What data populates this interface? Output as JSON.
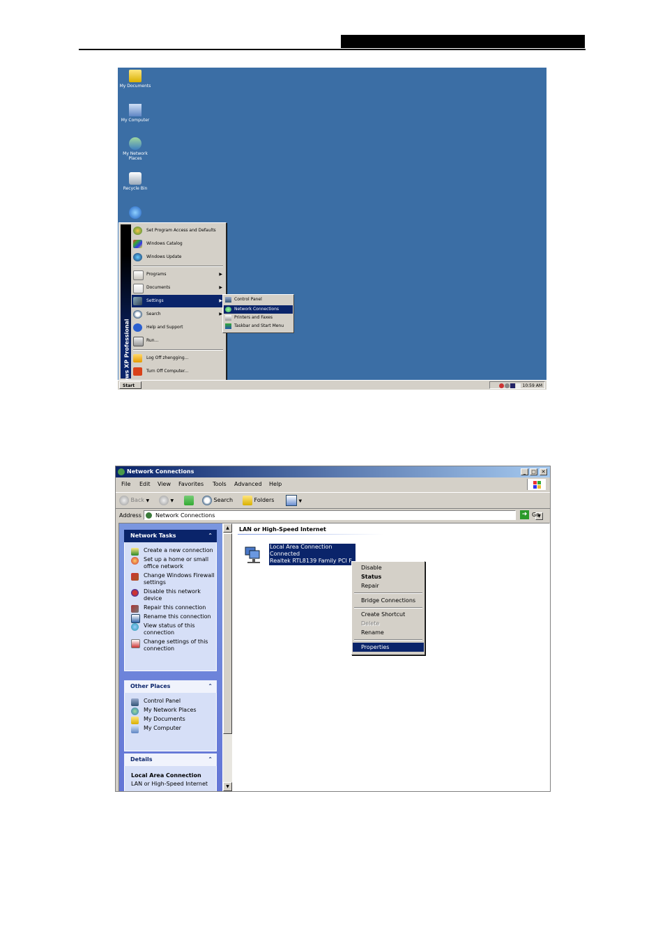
{
  "desktop": {
    "icons": [
      {
        "label": "My Documents"
      },
      {
        "label": "My Computer"
      },
      {
        "label": "My Network Places"
      },
      {
        "label": "Recycle Bin"
      }
    ],
    "start_menu": {
      "band_text": "Windows XP  Professional",
      "items": [
        {
          "label": "Set Program Access and Defaults"
        },
        {
          "label": "Windows Catalog"
        },
        {
          "label": "Windows Update"
        },
        {
          "label": "Programs"
        },
        {
          "label": "Documents"
        },
        {
          "label": "Settings"
        },
        {
          "label": "Search"
        },
        {
          "label": "Help and Support"
        },
        {
          "label": "Run..."
        },
        {
          "label": "Log Off zhengging..."
        },
        {
          "label": "Turn Off Computer..."
        }
      ]
    },
    "settings_submenu": [
      {
        "label": "Control Panel"
      },
      {
        "label": "Network Connections"
      },
      {
        "label": "Printers and Faxes"
      },
      {
        "label": "Taskbar and Start Menu"
      }
    ],
    "taskbar": {
      "start_label": "Start",
      "clock": "10:59 AM"
    }
  },
  "window": {
    "title": "Network Connections",
    "menu": [
      "File",
      "Edit",
      "View",
      "Favorites",
      "Tools",
      "Advanced",
      "Help"
    ],
    "toolbar": {
      "back": "Back",
      "search": "Search",
      "folders": "Folders"
    },
    "address": {
      "label": "Address",
      "value": "Network Connections",
      "go": "Go"
    },
    "network_tasks": {
      "title": "Network Tasks",
      "items": [
        "Create a new connection",
        "Set up a home or small office network",
        "Change Windows Firewall settings",
        "Disable this network device",
        "Repair this connection",
        "Rename this connection",
        "View status of this connection",
        "Change settings of this connection"
      ]
    },
    "other_places": {
      "title": "Other Places",
      "items": [
        "Control Panel",
        "My Network Places",
        "My Documents",
        "My Computer"
      ]
    },
    "details": {
      "title": "Details",
      "name": "Local Area Connection",
      "type": "LAN or High-Speed Internet"
    },
    "group_header": "LAN or High-Speed Internet",
    "connection": {
      "name": "Local Area Connection",
      "status": "Connected",
      "device": "Realtek RTL8139 Family PCI F..."
    },
    "context_menu": [
      "Disable",
      "Status",
      "Repair",
      "Bridge Connections",
      "Create Shortcut",
      "Delete",
      "Rename",
      "Properties"
    ]
  }
}
